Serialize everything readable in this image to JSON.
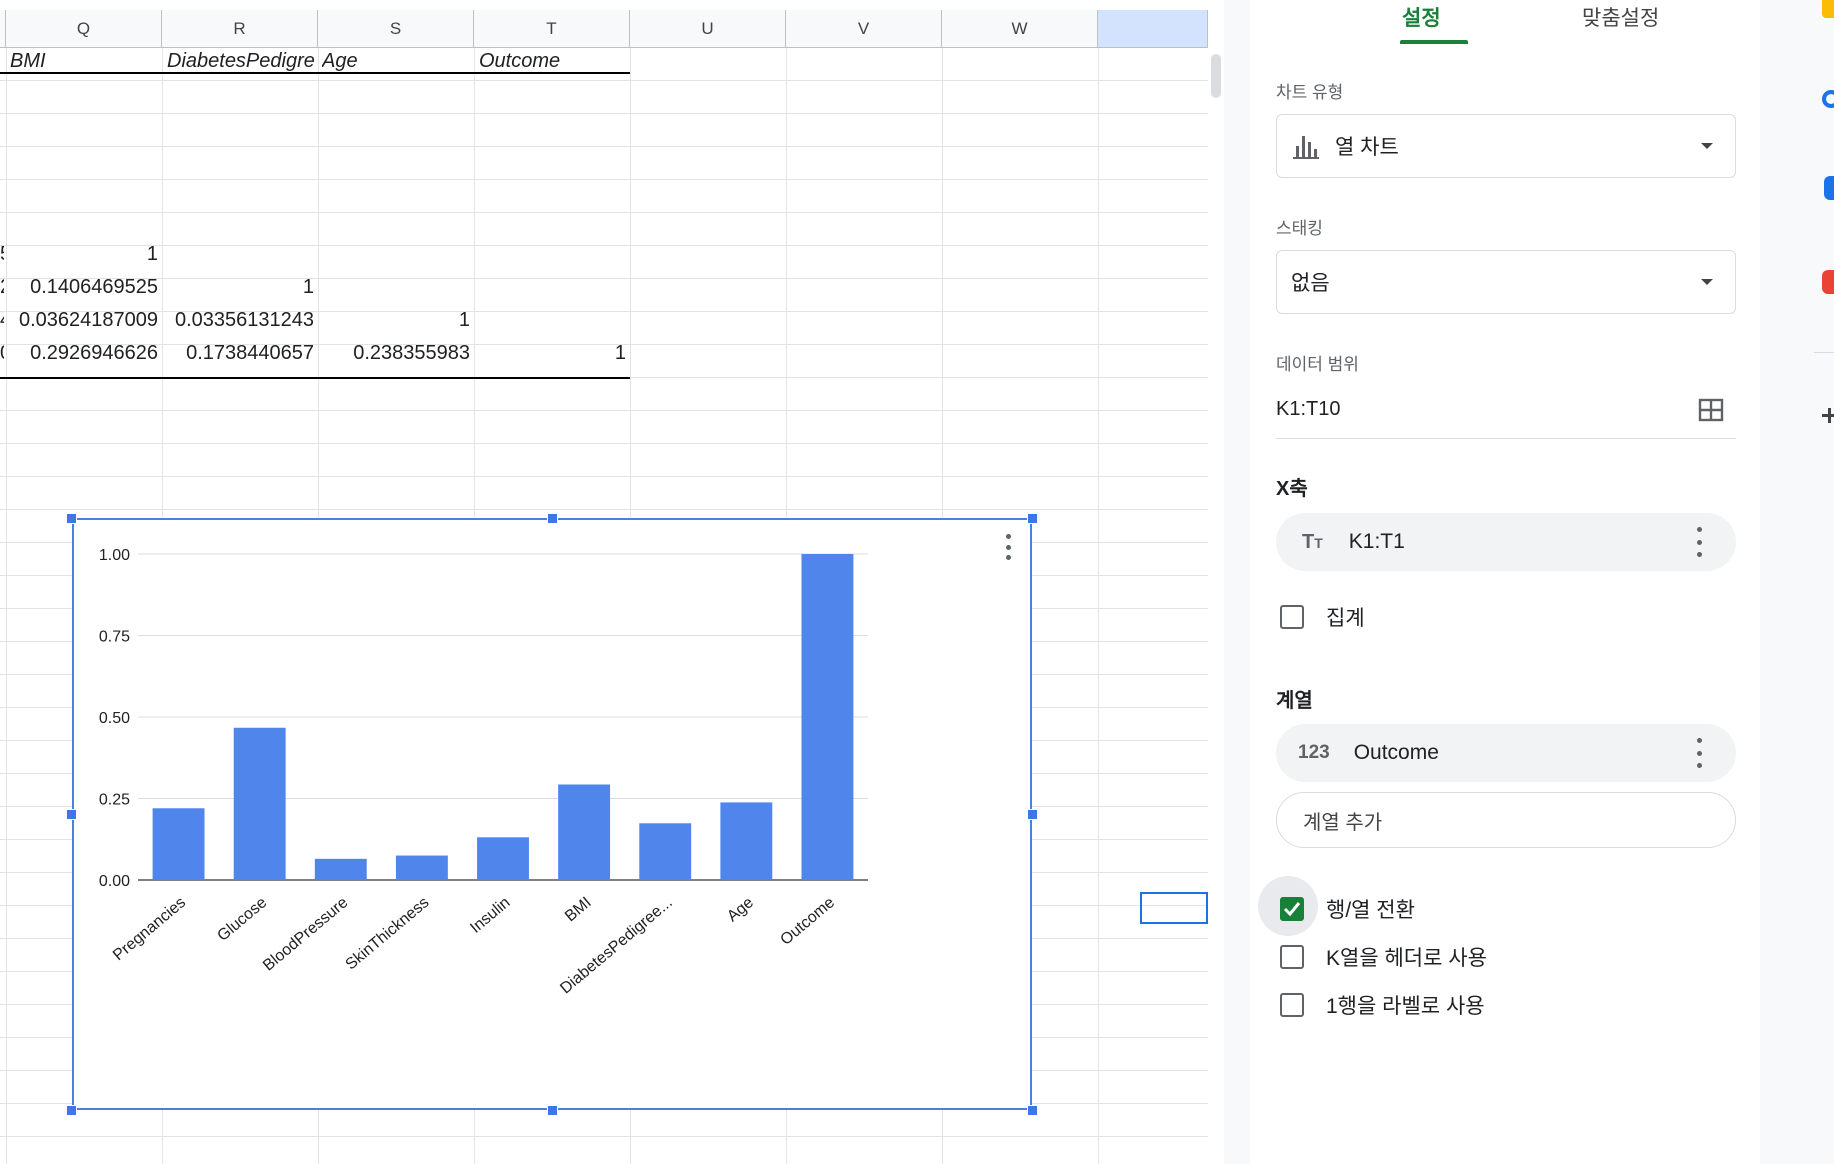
{
  "sheet": {
    "columns": [
      "Q",
      "R",
      "S",
      "T",
      "U",
      "V",
      "W"
    ],
    "header_row": {
      "q": "BMI",
      "r": "DiabetesPedigre",
      "s": "Age",
      "t": "Outcome"
    },
    "row_ones": {
      "q": "1",
      "r": "1",
      "s": "1",
      "t": "1"
    },
    "row_bmi_edge": "5",
    "row_dp": {
      "edge": "2",
      "q": "0.1406469525"
    },
    "row_age": {
      "edge": "4",
      "q": "0.03624187009",
      "r": "0.03356131243"
    },
    "row_outcome": {
      "edge": "0",
      "q": "0.2926946626",
      "r": "0.1738440657",
      "s": "0.238355983"
    }
  },
  "chart_data": {
    "type": "bar",
    "categories": [
      "Pregnancies",
      "Glucose",
      "BloodPressure",
      "SkinThickness",
      "Insulin",
      "BMI",
      "DiabetesPedigree...",
      "Age",
      "Outcome"
    ],
    "values": [
      0.22,
      0.467,
      0.065,
      0.075,
      0.131,
      0.293,
      0.174,
      0.238,
      1.0
    ],
    "ylim": [
      0,
      1
    ],
    "yticks": [
      "1.00",
      "0.75",
      "0.50",
      "0.25",
      "0.00"
    ],
    "title": "",
    "xlabel": "",
    "ylabel": "",
    "grid": true,
    "colors": {
      "bar": "#5086ec"
    }
  },
  "panel": {
    "tabs": {
      "setup": "설정",
      "customize": "맞춤설정"
    },
    "chart_type": {
      "label": "차트 유형",
      "value": "열 차트"
    },
    "stacking": {
      "label": "스태킹",
      "value": "없음"
    },
    "data_range": {
      "label": "데이터 범위",
      "value": "K1:T10"
    },
    "x_axis": {
      "label": "X축",
      "value": "K1:T1"
    },
    "aggregate": {
      "label": "집계",
      "checked": false
    },
    "series": {
      "label": "계열",
      "value": "Outcome",
      "type_icon": "123"
    },
    "add_series": "계열 추가",
    "switch_rows_cols": {
      "label": "행/열 전환",
      "checked": true
    },
    "use_col_k_header": {
      "label": "K열을 헤더로 사용",
      "checked": false
    },
    "use_row1_labels": {
      "label": "1행을 라벨로 사용",
      "checked": false
    }
  },
  "colors": {
    "accent_green": "#188038",
    "selection_blue": "#1a73e8"
  }
}
